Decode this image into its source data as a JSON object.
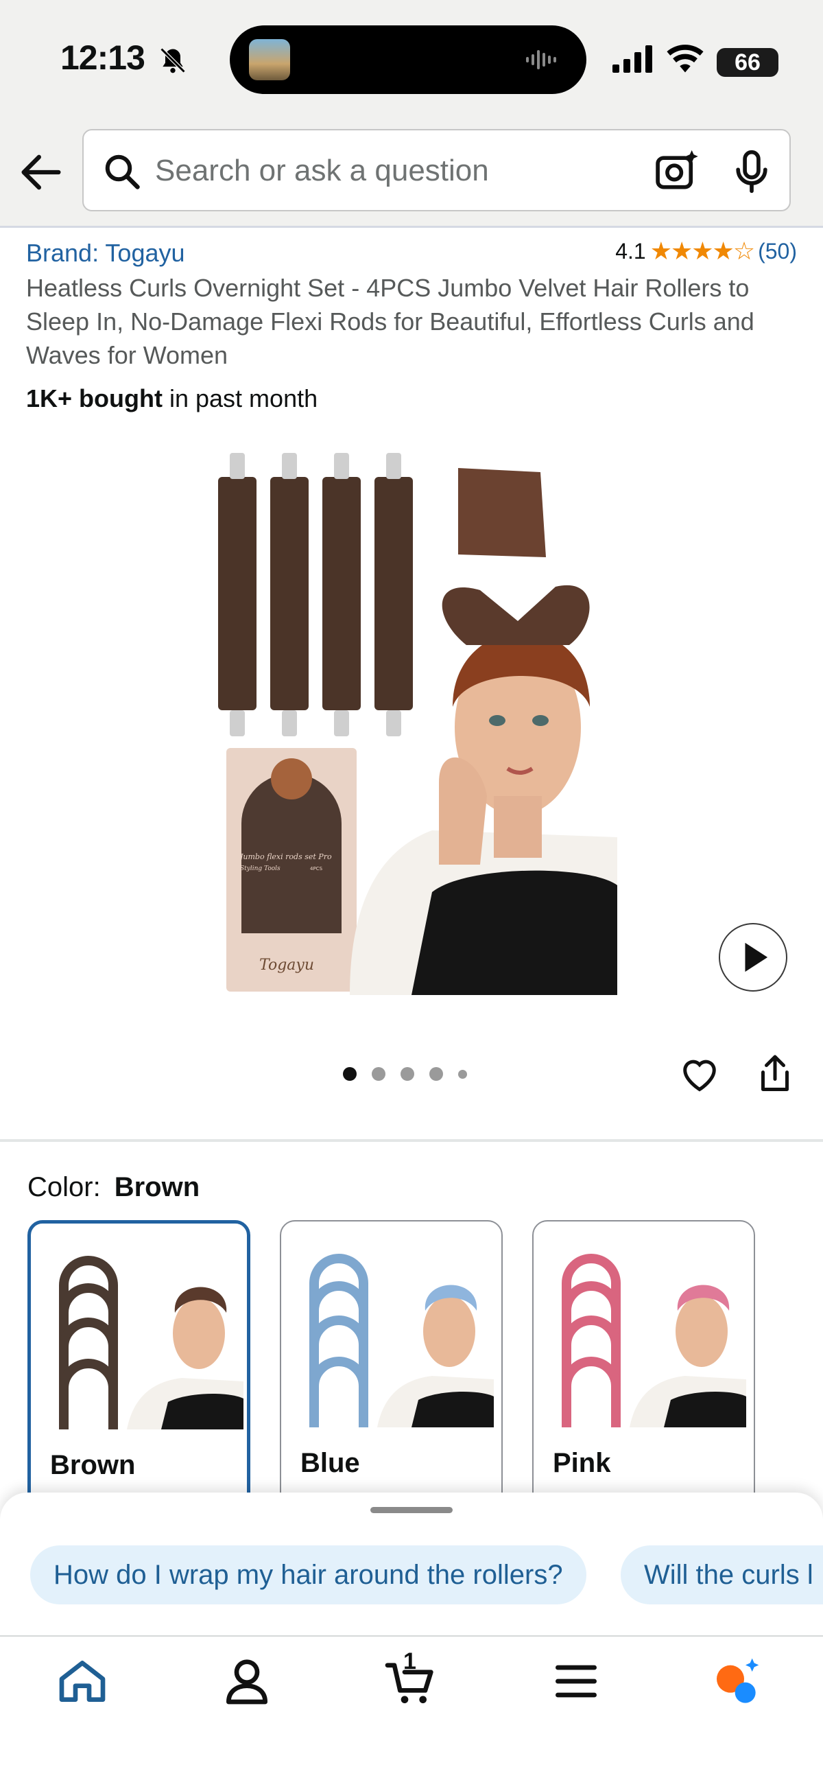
{
  "status_bar": {
    "time": "12:13",
    "battery": "66"
  },
  "search": {
    "placeholder": "Search or ask a question"
  },
  "product": {
    "brand": "Brand: Togayu",
    "rating_value": "4.1",
    "rating_stars": 4.1,
    "review_count": "(50)",
    "title": "Heatless Curls Overnight Set - 4PCS Jumbo Velvet Hair Rollers to Sleep In, No-Damage Flexi Rods for Beautiful, Effortless Curls and Waves for Women",
    "bought_bold": "1K+ bought",
    "bought_rest": " in past month",
    "box_brand": "Togayu",
    "box_text": "Jumbo flexi rods set Pro",
    "box_text2": "Styling Tools",
    "box_badge": "4PCS"
  },
  "gallery": {
    "image_count": 5,
    "active_index": 0
  },
  "color": {
    "label": "Color:",
    "selected": "Brown",
    "options": [
      {
        "name": "Brown",
        "color": "#4a3a31"
      },
      {
        "name": "Blue",
        "color": "#7ea7cf"
      },
      {
        "name": "Pink",
        "color": "#d9657f"
      }
    ]
  },
  "questions": [
    "How do I wrap my hair around the rollers?",
    "Will the curls l"
  ],
  "tabs": {
    "cart_count": "1"
  },
  "colors": {
    "link": "#2162a1",
    "star": "#f08804",
    "chip_bg": "#e3f1fb",
    "ai_orange": "#ff6a13",
    "ai_blue": "#1a8cff"
  }
}
